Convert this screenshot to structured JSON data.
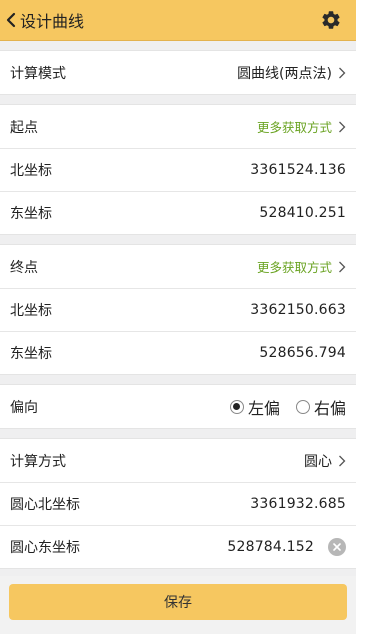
{
  "header": {
    "title": "设计曲线",
    "back_icon": "chevron-left-icon",
    "settings_icon": "gear-icon"
  },
  "calc_mode": {
    "label": "计算模式",
    "value": "圆曲线(两点法)"
  },
  "start_point": {
    "label": "起点",
    "more_link": "更多获取方式",
    "north_label": "北坐标",
    "north_value": "3361524.136",
    "east_label": "东坐标",
    "east_value": "528410.251"
  },
  "end_point": {
    "label": "终点",
    "more_link": "更多获取方式",
    "north_label": "北坐标",
    "north_value": "3362150.663",
    "east_label": "东坐标",
    "east_value": "528656.794"
  },
  "offset": {
    "label": "偏向",
    "left_label": "左偏",
    "right_label": "右偏",
    "selected": "left"
  },
  "calc_method": {
    "label": "计算方式",
    "value": "圆心",
    "center_north_label": "圆心北坐标",
    "center_north_value": "3361932.685",
    "center_east_label": "圆心东坐标",
    "center_east_value": "528784.152"
  },
  "footer": {
    "save_label": "保存"
  },
  "colors": {
    "accent": "#f6c760",
    "link_green": "#6aa322"
  }
}
